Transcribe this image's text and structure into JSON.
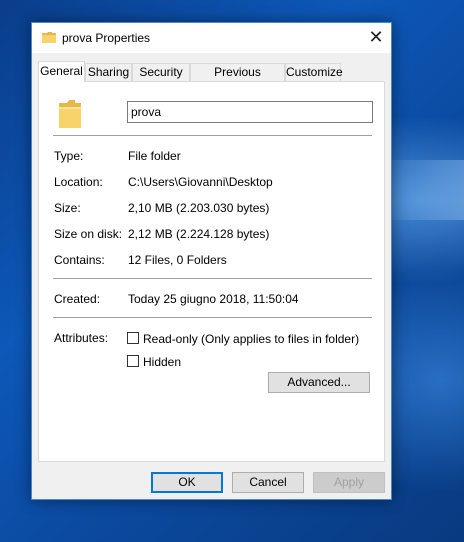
{
  "window": {
    "title": "prova Properties",
    "close_glyph": "✕"
  },
  "tabs": [
    {
      "label": "General",
      "active": true
    },
    {
      "label": "Sharing"
    },
    {
      "label": "Security"
    },
    {
      "label": "Previous Versions"
    },
    {
      "label": "Customize"
    }
  ],
  "general": {
    "name_value": "prova",
    "type_label": "Type:",
    "type_value": "File folder",
    "location_label": "Location:",
    "location_value": "C:\\Users\\Giovanni\\Desktop",
    "size_label": "Size:",
    "size_value": "2,10 MB (2.203.030 bytes)",
    "size_on_disk_label": "Size on disk:",
    "size_on_disk_value": "2,12 MB (2.224.128 bytes)",
    "contains_label": "Contains:",
    "contains_value": "12 Files, 0 Folders",
    "created_label": "Created:",
    "created_value": "Today 25 giugno 2018, 11:50:04",
    "attributes_label": "Attributes:",
    "readonly_label": "Read-only (Only applies to files in folder)",
    "readonly_checked": false,
    "hidden_label": "Hidden",
    "hidden_checked": false,
    "advanced_label": "Advanced..."
  },
  "footer": {
    "ok_label": "OK",
    "cancel_label": "Cancel",
    "apply_label": "Apply"
  },
  "colors": {
    "folder_yellow": "#f8d36a",
    "folder_dark": "#e6b84a",
    "focus_blue": "#0078d7"
  },
  "icons": {
    "title": "folder-icon",
    "large": "folder-icon"
  }
}
